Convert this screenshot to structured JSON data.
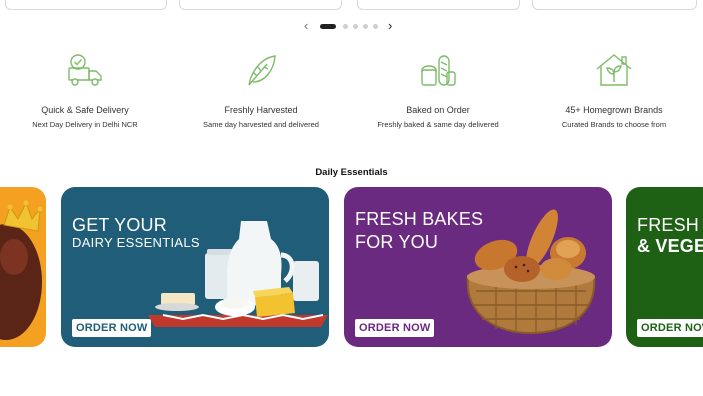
{
  "pager": {
    "prev_icon": "chevron-left-icon",
    "next_icon": "chevron-right-icon",
    "active_index": 0,
    "dot_count": 5
  },
  "features": [
    {
      "icon": "delivery-truck-icon",
      "title": "Quick & Safe Delivery",
      "subtitle": "Next Day Delivery in Delhi NCR"
    },
    {
      "icon": "leaf-icon",
      "title": "Freshly Harvested",
      "subtitle": "Same day harvested and delivered"
    },
    {
      "icon": "bread-icon",
      "title": "Baked on Order",
      "subtitle": "Freshly baked & same day delivered"
    },
    {
      "icon": "home-plant-icon",
      "title": "45+ Homegrown Brands",
      "subtitle": "Curated Brands to choose from"
    }
  ],
  "section_title": "Daily Essentials",
  "banners": [
    {
      "line1": "GET YOUR",
      "line2": "DAIRY ESSENTIALS",
      "cta": "ORDER NOW",
      "color": "#1f5d78"
    },
    {
      "line1": "FRESH BAKES",
      "line2": "FOR YOU",
      "cta": "ORDER NOW",
      "color": "#6a2a80"
    },
    {
      "line1": "FRESH F",
      "line2": "& VEGE",
      "cta": "ORDER NOW",
      "color": "#1e6115"
    }
  ],
  "colors": {
    "icon_green": "#7dbb6a",
    "orange_banner": "#f4a020"
  }
}
